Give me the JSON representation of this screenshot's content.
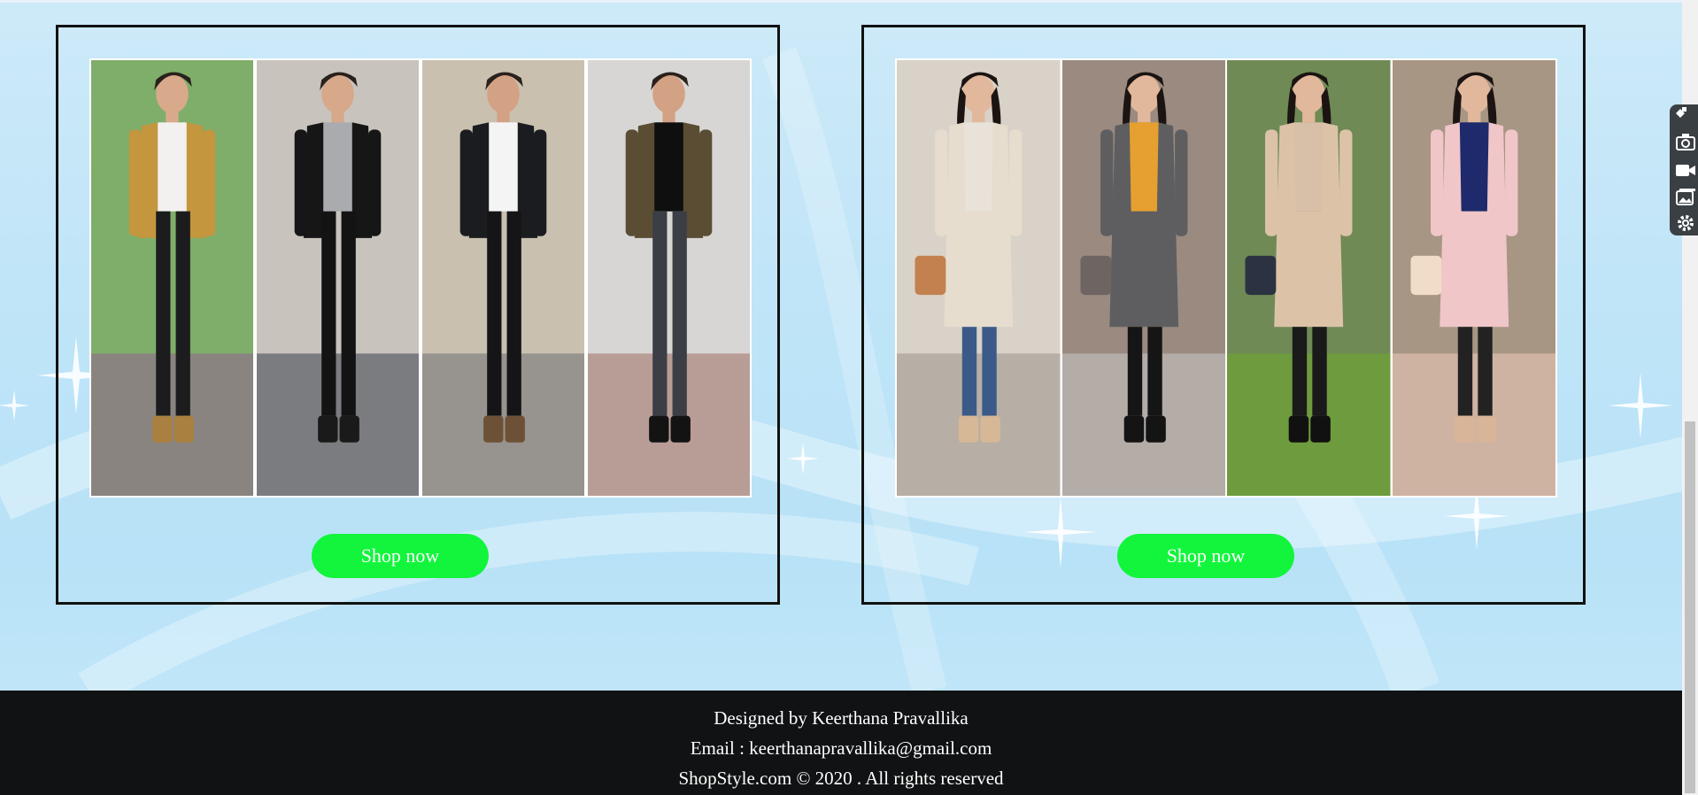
{
  "products": [
    {
      "id": "men",
      "button_label": "Shop now",
      "photos": [
        {
          "name": "men-outfit-white-tee-photo",
          "bg": "#7fae6a",
          "ground": "#8a8480",
          "top": "#f3f1f0",
          "jacket": "#c4963e",
          "pants": "#1c1c1e",
          "shoes": "#a9803f",
          "skin": "#d9a98c"
        },
        {
          "name": "men-outfit-grey-hoodie-photo",
          "bg": "#c8c4bd",
          "ground": "#7b7c80",
          "top": "#a9abae",
          "jacket": "#161616",
          "pants": "#131314",
          "shoes": "#1a1a1a",
          "skin": "#d8a88a"
        },
        {
          "name": "men-outfit-denim-jacket-photo",
          "bg": "#c9c0b0",
          "ground": "#97938e",
          "top": "#f4f4f4",
          "jacket": "#1b1c20",
          "pants": "#151518",
          "shoes": "#6d5136",
          "skin": "#d3a184"
        },
        {
          "name": "men-outfit-camo-jacket-photo",
          "bg": "#d8d6d4",
          "ground": "#b89d96",
          "top": "#0f0f0f",
          "jacket": "#5a4d34",
          "pants": "#3b3e45",
          "shoes": "#131313",
          "skin": "#d3a184"
        }
      ]
    },
    {
      "id": "women",
      "button_label": "Shop now",
      "photos": [
        {
          "name": "women-outfit-trench-coat-photo",
          "bg": "#d9d2c8",
          "ground": "#b7aea6",
          "top": "#e8e2d8",
          "jacket": "#e6ddcf",
          "pants": "#3b5a88",
          "shoes": "#d6b896",
          "skin": "#e2b89c",
          "bag": "#c2814e"
        },
        {
          "name": "women-outfit-grey-coat-photo",
          "bg": "#9b8a80",
          "ground": "#b3aca7",
          "top": "#e5a030",
          "jacket": "#5e5e60",
          "pants": "#151515",
          "shoes": "#141414",
          "skin": "#e2b89c",
          "bag": "#6e6462"
        },
        {
          "name": "women-outfit-camel-coat-photo",
          "bg": "#6f8a55",
          "ground": "#6e9b3e",
          "top": "#d8bfa8",
          "jacket": "#dcc3a8",
          "pants": "#1a1a1a",
          "shoes": "#111111",
          "skin": "#e2b89c",
          "bag": "#2b3342"
        },
        {
          "name": "women-outfit-pink-coat-photo",
          "bg": "#a89684",
          "ground": "#cfb3a2",
          "top": "#1e2a6b",
          "jacket": "#f0c6c8",
          "pants": "#222222",
          "shoes": "#d8b499",
          "skin": "#e2b89c",
          "bag": "#f1dcc7"
        }
      ]
    }
  ],
  "footer": {
    "designer": "Designed by Keerthana Pravallika",
    "email": "Email : keerthanapravallika@gmail.com",
    "copyright": "ShopStyle.com © 2020 . All rights reserved"
  },
  "colors": {
    "button_bg": "#12f53c",
    "footer_bg": "#101213",
    "page_bg": "#bfe4f8"
  },
  "toolbar_icons": [
    "extension-pin-icon",
    "camera-icon",
    "video-camera-icon",
    "image-gallery-icon",
    "gear-icon"
  ]
}
